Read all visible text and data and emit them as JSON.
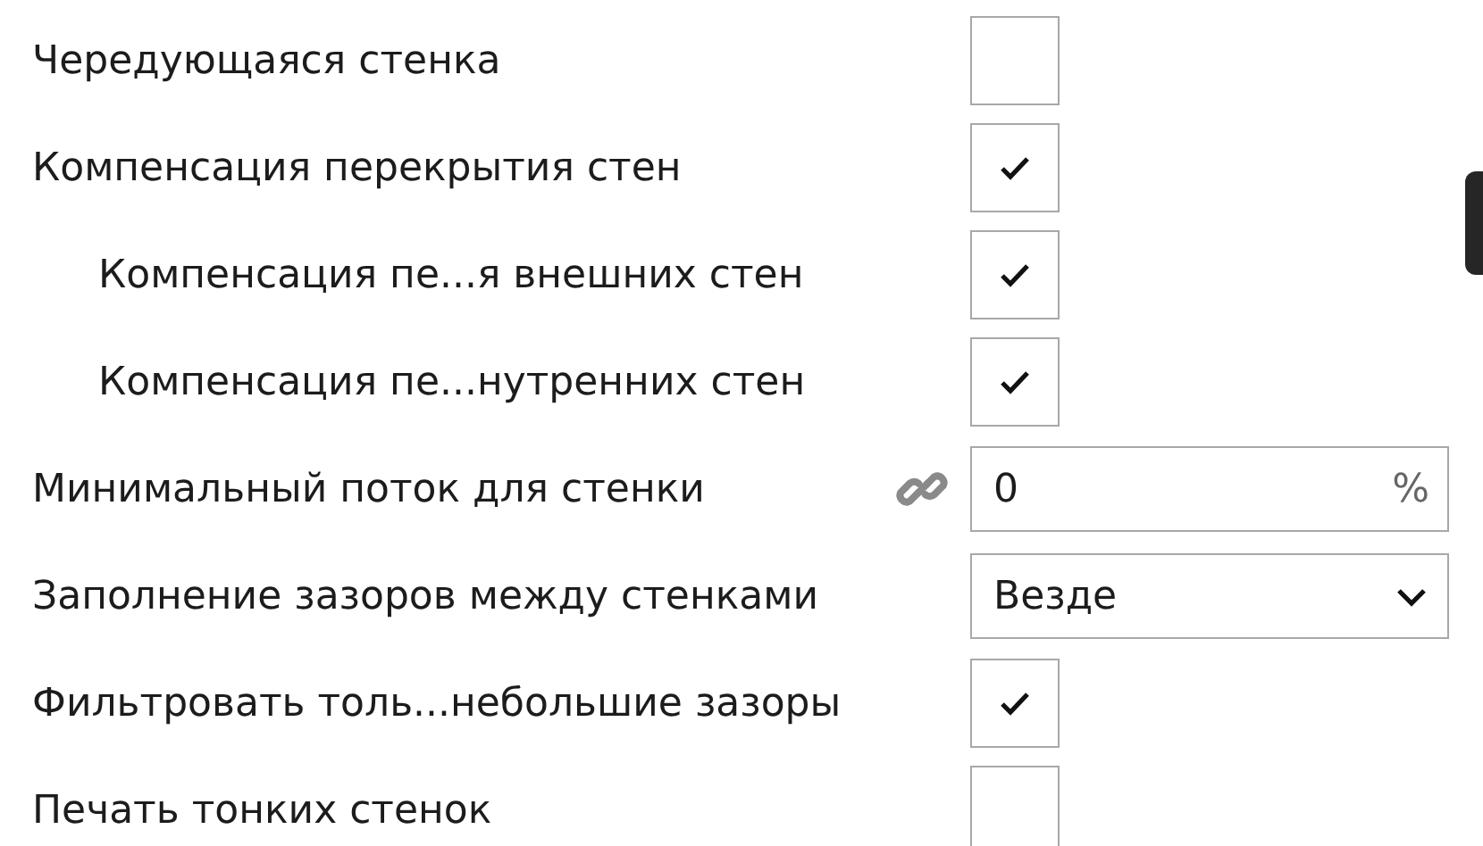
{
  "settings": [
    {
      "kind": "checkbox",
      "label": "Чередующаяся стенка",
      "indented": false,
      "checked": false
    },
    {
      "kind": "checkbox",
      "label": "Компенсация перекрытия стен",
      "indented": false,
      "checked": true
    },
    {
      "kind": "checkbox",
      "label": "Компенсация пе...я внешних стен",
      "indented": true,
      "checked": true
    },
    {
      "kind": "checkbox",
      "label": "Компенсация пе...нутренних стен",
      "indented": true,
      "checked": true
    },
    {
      "kind": "number",
      "label": "Минимальный поток для стенки",
      "indented": false,
      "linked": true,
      "value": "0",
      "unit": "%"
    },
    {
      "kind": "select",
      "label": "Заполнение зазоров между стенками",
      "indented": false,
      "value": "Везде"
    },
    {
      "kind": "checkbox",
      "label": "Фильтровать толь...небольшие зазоры",
      "indented": false,
      "checked": true
    },
    {
      "kind": "checkbox",
      "label": "Печать тонких стенок",
      "indented": false,
      "checked": false
    }
  ]
}
